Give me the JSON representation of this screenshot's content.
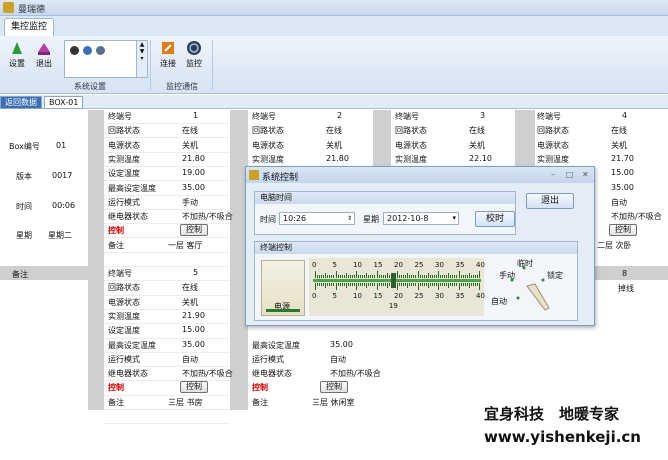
{
  "app": {
    "title": "曼瑞德"
  },
  "main_tab": "集控监控",
  "ribbon": {
    "settings": "设置",
    "exit": "退出",
    "group1": "系统设置",
    "connect": "连接",
    "monitor": "监控",
    "group2": "监控通信"
  },
  "doc_tabs": [
    "返回数据",
    "BOX-01"
  ],
  "left_labels": {
    "box_no": "Box编号",
    "box_val": "01",
    "version": "版本",
    "version_val": "0017",
    "time": "时间",
    "time_val": "00:06",
    "weekday": "星期",
    "weekday_val": "星期二",
    "note": "备注"
  },
  "labels": {
    "terminal": "终端号",
    "loop": "回路状态",
    "power": "电源状态",
    "room": "实测温度",
    "set": "设定温度",
    "max": "最高设定温度",
    "mode": "运行模式",
    "relay": "继电器状态",
    "ctrl": "控制",
    "ctrl_btn": "控制",
    "note": "备注"
  },
  "units": [
    {
      "no": "1",
      "loop": "在线",
      "power": "关机",
      "room": "21.80",
      "set": "19.00",
      "max": "35.00",
      "mode": "手动",
      "relay": "不加热/不吸合",
      "note": "一层 客厅"
    },
    {
      "no": "2",
      "loop": "在线",
      "power": "关机",
      "room": "21.80"
    },
    {
      "no": "3",
      "loop": "在线",
      "power": "关机",
      "room": "22.10"
    },
    {
      "no": "4",
      "loop": "在线",
      "power": "关机",
      "room": "21.70",
      "set": "15.00",
      "max": "35.00",
      "mode": "自动",
      "relay": "不加热/不吸合",
      "note": "二层 次卧"
    },
    {
      "no": "5",
      "loop": "在线",
      "power": "关机",
      "room": "21.90",
      "set": "15.00",
      "max": "35.00",
      "mode": "自动",
      "relay": "不加热/不吸合",
      "note": "三层 书房"
    },
    {
      "max": "35.00",
      "mode": "自动",
      "relay": "不加热/不吸合",
      "note": "三层 休闲室"
    },
    {
      "no": "8",
      "loop": "掉线"
    }
  ],
  "dialog": {
    "title": "系统控制",
    "clock_section": "电脑时间",
    "time_label": "时间",
    "time_value": "10:26",
    "weekday_label": "星期",
    "date_value": "2012-10-8",
    "calibrate": "校时",
    "exit": "退出",
    "terminal_section": "终端控制",
    "power": "电源",
    "ruler_ticks": [
      "0",
      "5",
      "10",
      "15",
      "20",
      "25",
      "30",
      "35",
      "40"
    ],
    "slider_value": "19",
    "knob_labels": {
      "temp": "临时",
      "manual": "手动",
      "lock": "锁定",
      "auto": "自动"
    }
  },
  "footer": {
    "line1": "宜身科技　地暖专家",
    "line2": "www.yishenkeji.cn"
  }
}
